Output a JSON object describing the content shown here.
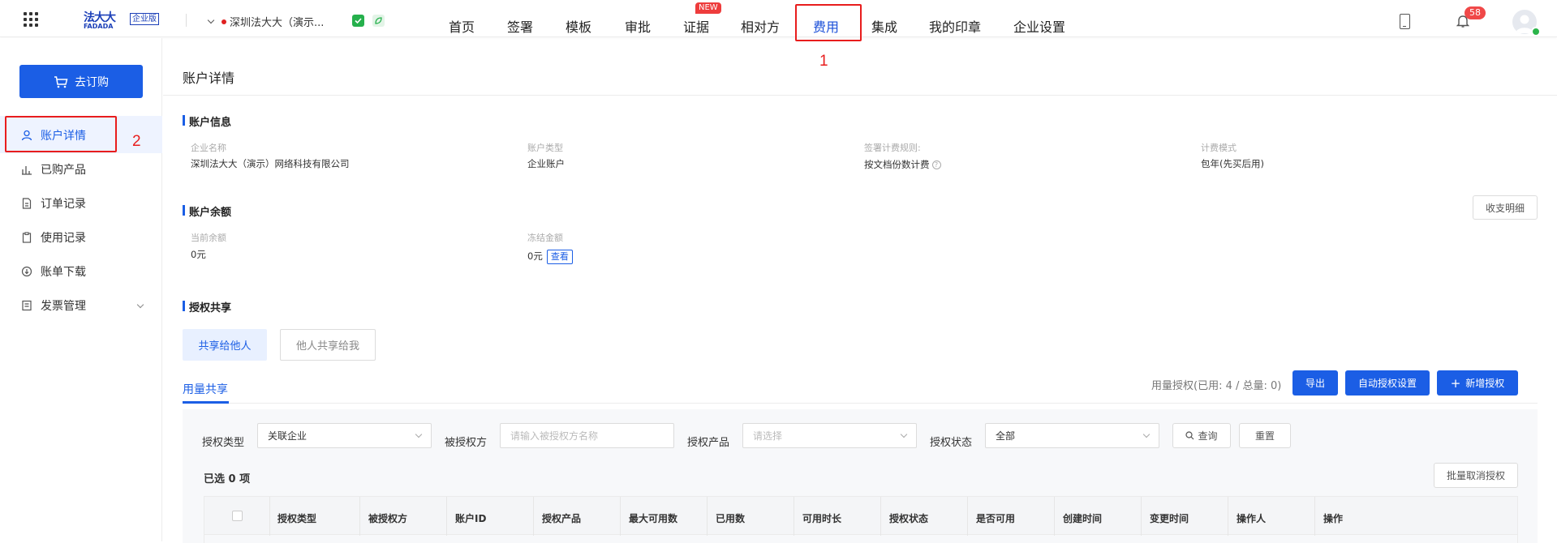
{
  "header": {
    "logo_cn": "法大大",
    "logo_en": "FADADA",
    "logo_badge": "企业版",
    "company_name": "深圳法大大（演示...",
    "nav": [
      {
        "label": "首页"
      },
      {
        "label": "签署"
      },
      {
        "label": "模板"
      },
      {
        "label": "审批"
      },
      {
        "label": "证据",
        "badge": "NEW"
      },
      {
        "label": "相对方"
      },
      {
        "label": "费用",
        "active": true
      },
      {
        "label": "集成"
      },
      {
        "label": "我的印章"
      },
      {
        "label": "企业设置"
      }
    ],
    "notification_count": "58",
    "annotation_nav": "1"
  },
  "sidebar": {
    "buy_button": "去订购",
    "items": [
      {
        "label": "账户详情",
        "active": true,
        "icon": "user-icon"
      },
      {
        "label": "已购产品",
        "icon": "bar-chart-icon"
      },
      {
        "label": "订单记录",
        "icon": "document-icon"
      },
      {
        "label": "使用记录",
        "icon": "clipboard-icon"
      },
      {
        "label": "账单下载",
        "icon": "download-icon"
      },
      {
        "label": "发票管理",
        "icon": "invoice-icon"
      }
    ],
    "annotation_side": "2"
  },
  "main": {
    "page_title": "账户详情",
    "account_info": {
      "title": "账户信息",
      "fields": [
        {
          "label": "企业名称",
          "value": "深圳法大大（演示）网络科技有限公司"
        },
        {
          "label": "账户类型",
          "value": "企业账户"
        },
        {
          "label": "签署计费规则:",
          "value": "按文档份数计费"
        },
        {
          "label": "计费模式",
          "value": "包年(先买后用)"
        }
      ]
    },
    "balance": {
      "title": "账户余额",
      "detail_button": "收支明细",
      "current_label": "当前余额",
      "current_value": "0元",
      "frozen_label": "冻结金额",
      "frozen_value": "0元",
      "view_link": "查看"
    },
    "share": {
      "title": "授权共享",
      "tabs": [
        "共享给他人",
        "他人共享给我"
      ],
      "sub_tab": "用量共享",
      "quota_text": "用量授权(已用: 4 / 总量: 0)",
      "export_button": "导出",
      "auto_button": "自动授权设置",
      "add_button": "新增授权",
      "add_icon": "plus-icon"
    },
    "filters": {
      "type_label": "授权类型",
      "type_value": "关联企业",
      "grantee_label": "被授权方",
      "grantee_placeholder": "请输入被授权方名称",
      "product_label": "授权产品",
      "product_placeholder": "请选择",
      "status_label": "授权状态",
      "status_value": "全部",
      "query_button": "查询",
      "reset_button": "重置"
    },
    "table": {
      "selected_text": "已选 0 项",
      "batch_cancel_button": "批量取消授权",
      "columns": [
        "授权类型",
        "被授权方",
        "账户ID",
        "授权产品",
        "最大可用数",
        "已用数",
        "可用时长",
        "授权状态",
        "是否可用",
        "创建时间",
        "变更时间",
        "操作人",
        "操作"
      ]
    }
  },
  "colors": {
    "primary": "#1b5ee5",
    "annotation": "#e81d1d",
    "badge": "#ee3c3c"
  }
}
